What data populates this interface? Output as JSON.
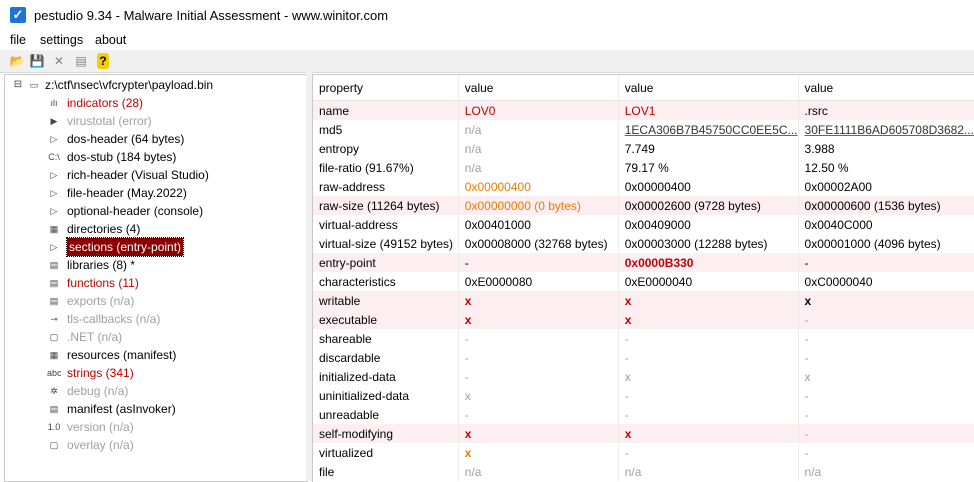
{
  "window": {
    "title": "pestudio 9.34 - Malware Initial Assessment - www.winitor.com"
  },
  "menu": [
    "file",
    "settings",
    "about"
  ],
  "toolbar": [
    {
      "name": "open-icon",
      "glyph": "📂"
    },
    {
      "name": "save-icon",
      "glyph": "💾"
    },
    {
      "name": "close-icon",
      "glyph": "✕"
    },
    {
      "name": "clipboard-icon",
      "glyph": "▤"
    },
    {
      "name": "help-icon",
      "glyph": "?"
    }
  ],
  "tree": [
    {
      "label": "z:\\ctf\\nsec\\vfcrypter\\payload.bin",
      "color": "black",
      "icon": "▭",
      "level": 0,
      "name": "tree-root"
    },
    {
      "label": "indicators (28)",
      "color": "red",
      "icon": "ılı",
      "level": 1,
      "name": "tree-item-indicators"
    },
    {
      "label": "virustotal (error)",
      "color": "gray",
      "icon": "▶",
      "level": 1,
      "name": "tree-item-virustotal"
    },
    {
      "label": "dos-header (64 bytes)",
      "color": "black",
      "icon": "▷",
      "level": 1,
      "name": "tree-item-dos-header"
    },
    {
      "label": "dos-stub (184 bytes)",
      "color": "black",
      "icon": "C:\\",
      "level": 1,
      "name": "tree-item-dos-stub"
    },
    {
      "label": "rich-header (Visual Studio)",
      "color": "black",
      "icon": "▷",
      "level": 1,
      "name": "tree-item-rich-header"
    },
    {
      "label": "file-header (May.2022)",
      "color": "black",
      "icon": "▷",
      "level": 1,
      "name": "tree-item-file-header"
    },
    {
      "label": "optional-header (console)",
      "color": "black",
      "icon": "▷",
      "level": 1,
      "name": "tree-item-optional-header"
    },
    {
      "label": "directories (4)",
      "color": "black",
      "icon": "▦",
      "level": 1,
      "name": "tree-item-directories"
    },
    {
      "label": "sections (entry-point)",
      "color": "selected",
      "icon": "▷",
      "level": 1,
      "name": "tree-item-sections"
    },
    {
      "label": "libraries (8) *",
      "color": "black",
      "icon": "▤",
      "level": 1,
      "name": "tree-item-libraries"
    },
    {
      "label": "functions (11)",
      "color": "red",
      "icon": "▤",
      "level": 1,
      "name": "tree-item-functions"
    },
    {
      "label": "exports (n/a)",
      "color": "gray",
      "icon": "▤",
      "level": 1,
      "name": "tree-item-exports"
    },
    {
      "label": "tls-callbacks (n/a)",
      "color": "gray",
      "icon": "⊸",
      "level": 1,
      "name": "tree-item-tls-callbacks"
    },
    {
      "label": ".NET (n/a)",
      "color": "gray",
      "icon": "▢",
      "level": 1,
      "name": "tree-item-dotnet"
    },
    {
      "label": "resources (manifest)",
      "color": "black",
      "icon": "▦",
      "level": 1,
      "name": "tree-item-resources"
    },
    {
      "label": "strings (341)",
      "color": "red",
      "icon": "abc",
      "level": 1,
      "name": "tree-item-strings"
    },
    {
      "label": "debug (n/a)",
      "color": "gray",
      "icon": "✲",
      "level": 1,
      "name": "tree-item-debug"
    },
    {
      "label": "manifest (asInvoker)",
      "color": "black",
      "icon": "▤",
      "level": 1,
      "name": "tree-item-manifest"
    },
    {
      "label": "version (n/a)",
      "color": "gray",
      "icon": "1.0",
      "level": 1,
      "name": "tree-item-version"
    },
    {
      "label": "overlay (n/a)",
      "color": "gray",
      "icon": "▢",
      "level": 1,
      "name": "tree-item-overlay"
    }
  ],
  "table": {
    "headers": [
      "property",
      "value",
      "value",
      "value"
    ],
    "rows": [
      {
        "pink": true,
        "cells": [
          {
            "t": "name"
          },
          {
            "t": "LOV0",
            "c": "red"
          },
          {
            "t": "LOV1",
            "c": "red"
          },
          {
            "t": ".rsrc"
          }
        ]
      },
      {
        "pink": false,
        "cells": [
          {
            "t": "md5"
          },
          {
            "t": "n/a",
            "c": "gray"
          },
          {
            "t": "1ECA306B7B45750CC0EE5C...",
            "c": "link"
          },
          {
            "t": "30FE1111B6AD605708D3682...",
            "c": "link"
          }
        ]
      },
      {
        "pink": false,
        "cells": [
          {
            "t": "entropy"
          },
          {
            "t": "n/a",
            "c": "gray"
          },
          {
            "t": "7.749"
          },
          {
            "t": "3.988"
          }
        ]
      },
      {
        "pink": false,
        "cells": [
          {
            "t": "file-ratio (91.67%)"
          },
          {
            "t": "n/a",
            "c": "gray"
          },
          {
            "t": "79.17 %"
          },
          {
            "t": "12.50 %"
          }
        ]
      },
      {
        "pink": false,
        "cells": [
          {
            "t": "raw-address"
          },
          {
            "t": "0x00000400",
            "c": "orange"
          },
          {
            "t": "0x00000400"
          },
          {
            "t": "0x00002A00"
          }
        ]
      },
      {
        "pink": true,
        "cells": [
          {
            "t": "raw-size (11264 bytes)"
          },
          {
            "t": "0x00000000 (0 bytes)",
            "c": "orange"
          },
          {
            "t": "0x00002600 (9728 bytes)"
          },
          {
            "t": "0x00000600 (1536 bytes)"
          }
        ]
      },
      {
        "pink": false,
        "cells": [
          {
            "t": "virtual-address"
          },
          {
            "t": "0x00401000"
          },
          {
            "t": "0x00409000"
          },
          {
            "t": "0x0040C000"
          }
        ]
      },
      {
        "pink": false,
        "cells": [
          {
            "t": "virtual-size (49152 bytes)"
          },
          {
            "t": "0x00008000 (32768 bytes)"
          },
          {
            "t": "0x00003000 (12288 bytes)"
          },
          {
            "t": "0x00001000 (4096 bytes)"
          }
        ]
      },
      {
        "pink": true,
        "cells": [
          {
            "t": "entry-point"
          },
          {
            "t": "-"
          },
          {
            "t": "0x0000B330",
            "c": "boldred"
          },
          {
            "t": "-"
          }
        ]
      },
      {
        "pink": false,
        "cells": [
          {
            "t": "characteristics"
          },
          {
            "t": "0xE0000080"
          },
          {
            "t": "0xE0000040"
          },
          {
            "t": "0xC0000040"
          }
        ]
      },
      {
        "pink": true,
        "cells": [
          {
            "t": "writable"
          },
          {
            "t": "x",
            "c": "xred"
          },
          {
            "t": "x",
            "c": "xred"
          },
          {
            "t": "x",
            "c": "xblack"
          }
        ]
      },
      {
        "pink": true,
        "cells": [
          {
            "t": "executable"
          },
          {
            "t": "x",
            "c": "xred"
          },
          {
            "t": "x",
            "c": "xred"
          },
          {
            "t": "-",
            "c": "gray"
          }
        ]
      },
      {
        "pink": false,
        "cells": [
          {
            "t": "shareable"
          },
          {
            "t": "-",
            "c": "gray"
          },
          {
            "t": "-",
            "c": "gray"
          },
          {
            "t": "-",
            "c": "gray"
          }
        ]
      },
      {
        "pink": false,
        "cells": [
          {
            "t": "discardable"
          },
          {
            "t": "-",
            "c": "gray"
          },
          {
            "t": "-",
            "c": "gray"
          },
          {
            "t": "-",
            "c": "gray"
          }
        ]
      },
      {
        "pink": false,
        "cells": [
          {
            "t": "initialized-data"
          },
          {
            "t": "-",
            "c": "gray"
          },
          {
            "t": "x",
            "c": "gray"
          },
          {
            "t": "x",
            "c": "gray"
          }
        ]
      },
      {
        "pink": false,
        "cells": [
          {
            "t": "uninitialized-data"
          },
          {
            "t": "x",
            "c": "gray"
          },
          {
            "t": "-",
            "c": "gray"
          },
          {
            "t": "-",
            "c": "gray"
          }
        ]
      },
      {
        "pink": false,
        "cells": [
          {
            "t": "unreadable"
          },
          {
            "t": "-",
            "c": "gray"
          },
          {
            "t": "-",
            "c": "gray"
          },
          {
            "t": "-",
            "c": "gray"
          }
        ]
      },
      {
        "pink": true,
        "cells": [
          {
            "t": "self-modifying"
          },
          {
            "t": "x",
            "c": "xred"
          },
          {
            "t": "x",
            "c": "xred"
          },
          {
            "t": "-",
            "c": "gray"
          }
        ]
      },
      {
        "pink": false,
        "cells": [
          {
            "t": "virtualized"
          },
          {
            "t": "x",
            "c": "xorange"
          },
          {
            "t": "-",
            "c": "gray"
          },
          {
            "t": "-",
            "c": "gray"
          }
        ]
      },
      {
        "pink": false,
        "cells": [
          {
            "t": "file"
          },
          {
            "t": "n/a",
            "c": "gray"
          },
          {
            "t": "n/a",
            "c": "gray"
          },
          {
            "t": "n/a",
            "c": "gray"
          }
        ]
      }
    ]
  }
}
